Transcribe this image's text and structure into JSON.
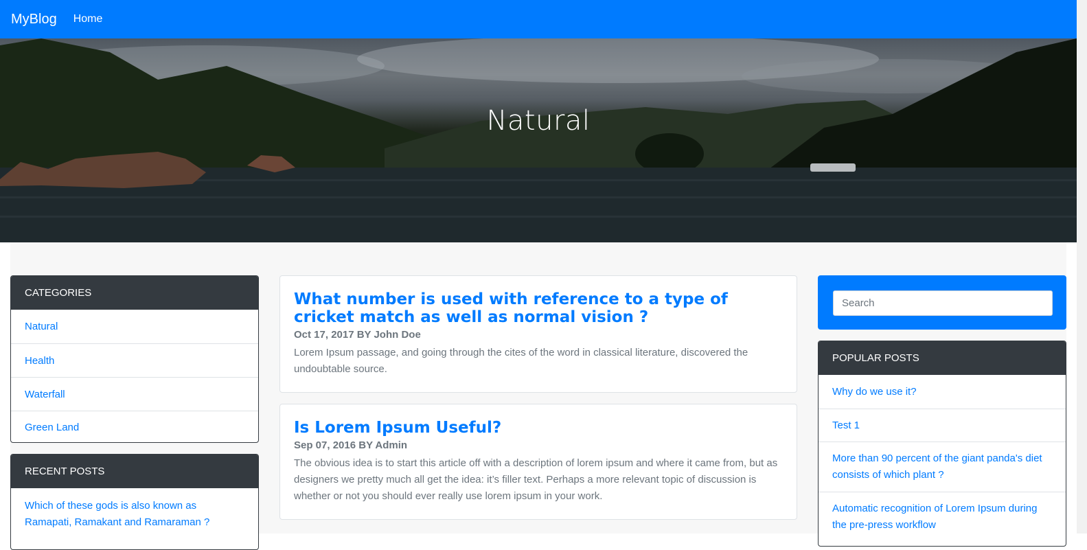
{
  "navbar": {
    "brand": "MyBlog",
    "links": [
      "Home"
    ]
  },
  "hero": {
    "title": "Natural"
  },
  "categories": {
    "header": "CATEGORIES",
    "items": [
      "Natural",
      "Health",
      "Waterfall",
      "Green Land"
    ]
  },
  "recent_posts": {
    "header": "RECENT POSTS",
    "items": [
      "Which of these gods is also known as Ramapati, Ramakant and Ramaraman ?"
    ]
  },
  "posts": [
    {
      "title": "What number is used with reference to a type of cricket match as well as normal vision ?",
      "meta": "Oct 17, 2017 BY John Doe",
      "excerpt": "Lorem Ipsum passage, and going through the cites of the word in classical literature, discovered the undoubtable source."
    },
    {
      "title": "Is Lorem Ipsum Useful?",
      "meta": "Sep 07, 2016 BY Admin",
      "excerpt": "The obvious idea is to start this article off with a description of lorem ipsum and where it came from, but as designers we pretty much all get the idea: it’s filler text. Perhaps a more relevant topic of discussion is whether or not you should ever really use lorem ipsum in your work."
    }
  ],
  "search": {
    "placeholder": "Search"
  },
  "popular_posts": {
    "header": "POPULAR POSTS",
    "items": [
      "Why do we use it?",
      "Test 1",
      "More than 90 percent of the giant panda's diet consists of which plant ?",
      "Automatic recognition of Lorem Ipsum during the pre-press workflow"
    ]
  },
  "colors": {
    "primary": "#007bff",
    "dark": "#343a40",
    "muted": "#6c757d",
    "background": "#f7f7f7"
  }
}
